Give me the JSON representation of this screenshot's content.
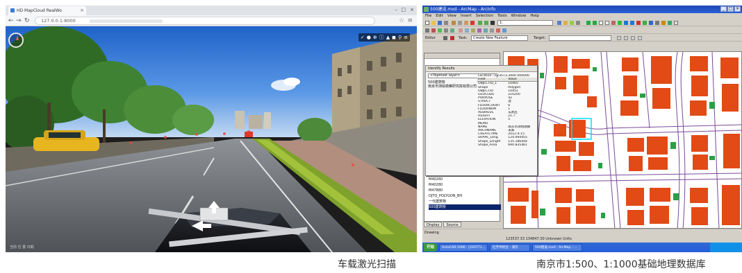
{
  "left": {
    "browser": {
      "tab_title": "HD MapCloud RealWo",
      "url": "127.0.0.1:8000"
    },
    "viewer": {
      "status_text": "当前 位 置 日期"
    },
    "caption": "车载激光扫描"
  },
  "right": {
    "arcmap": {
      "window_title": "500建设.mxd - ArcMap - ArcInfo",
      "menus": [
        "File",
        "Edit",
        "View",
        "Insert",
        "Selection",
        "Tools",
        "Window",
        "Help"
      ],
      "scale_value": "1:",
      "editor_label": "Editor",
      "task_label": "Task:",
      "task_value": "Create New Feature",
      "target_label": "Target:",
      "identify": {
        "title": "Identify Results",
        "layers_value": "<Topmost layer>",
        "tree": [
          "500建筑物",
          "南京市测绘勘察研究院有限公司"
        ],
        "location": "Location: (123573.3400 000000",
        "field_header": "Field",
        "value_header": "Value",
        "rows": [
          [
            "OBJECTID_1",
            "10465"
          ],
          [
            "Shape",
            "Polygon"
          ],
          [
            "OBJECTID",
            "10451"
          ],
          [
            "GEOCODE",
            "210200"
          ],
          [
            "PURPOSE",
            "42"
          ],
          [
            "STRUCT",
            "混"
          ],
          [
            "FLOORCOUNT",
            "6"
          ],
          [
            "FLOORNUM",
            "1"
          ],
          [
            "ADDRESS",
            "玄武区"
          ],
          [
            "HEIGHT",
            "21.7"
          ],
          [
            "ELEVATION",
            "5"
          ],
          [
            "MEMO",
            ""
          ],
          [
            "NAME",
            "南京市测绘勘察"
          ],
          [
            "ARCHNAME",
            "未知"
          ],
          [
            "CREATETIME",
            "2012-4-15"
          ],
          [
            "SHAPE_Leng",
            "124.094455"
          ],
          [
            "Shape_Length",
            "135.186444"
          ],
          [
            "Shape_Area",
            "690.835461"
          ]
        ]
      },
      "toc": {
        "layers": [
          "M40260",
          "M40280",
          "M47880",
          "DJTQ_POLYGON_BH",
          "一代建筑物",
          "500建筑物"
        ]
      },
      "toc_tabs": [
        "Display",
        "Source"
      ],
      "drawing_label": "Drawing",
      "status_coords": "123537.33 134847.30 Unknown Units",
      "taskbar_items": [
        "开始",
        "AutoCAD 2006 - [220771...",
        "红字件综合 - 演示",
        "500建设.mxd - ArcMap - ..."
      ]
    },
    "caption": "南京市1:500、1:1000基础地理数据库"
  }
}
